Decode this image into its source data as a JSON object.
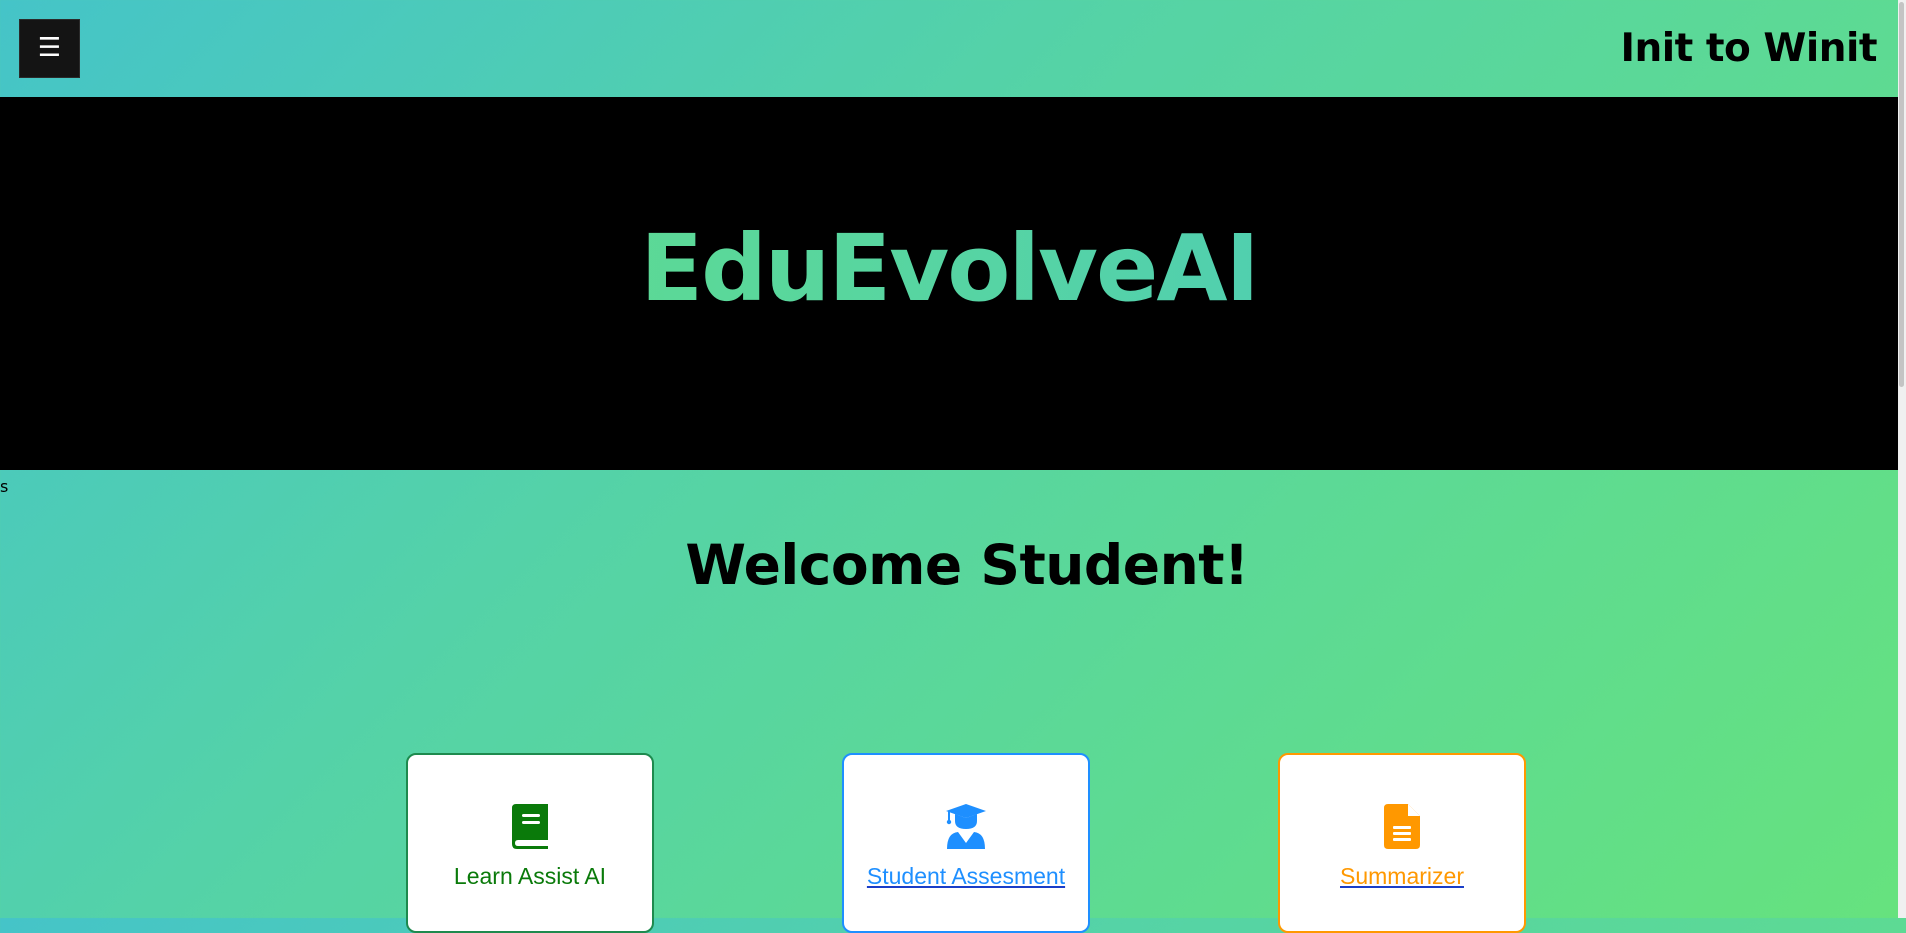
{
  "header": {
    "menu_icon": "☰",
    "team_name": "Init to Winit"
  },
  "hero": {
    "title": "EduEvolveAI"
  },
  "stray_text": "s",
  "welcome": "Welcome Student!",
  "cards": [
    {
      "label": "Learn Assist AI",
      "icon": "book-icon",
      "color": "#0a7a0a"
    },
    {
      "label": "Student Assesment",
      "icon": "graduate-icon",
      "color": "#1e8fff"
    },
    {
      "label": "Summarizer",
      "icon": "document-icon",
      "color": "#ff9800"
    }
  ],
  "colors": {
    "gradient_start": "#45c4c8",
    "gradient_end": "#66e27e",
    "hero_background": "#000000"
  }
}
